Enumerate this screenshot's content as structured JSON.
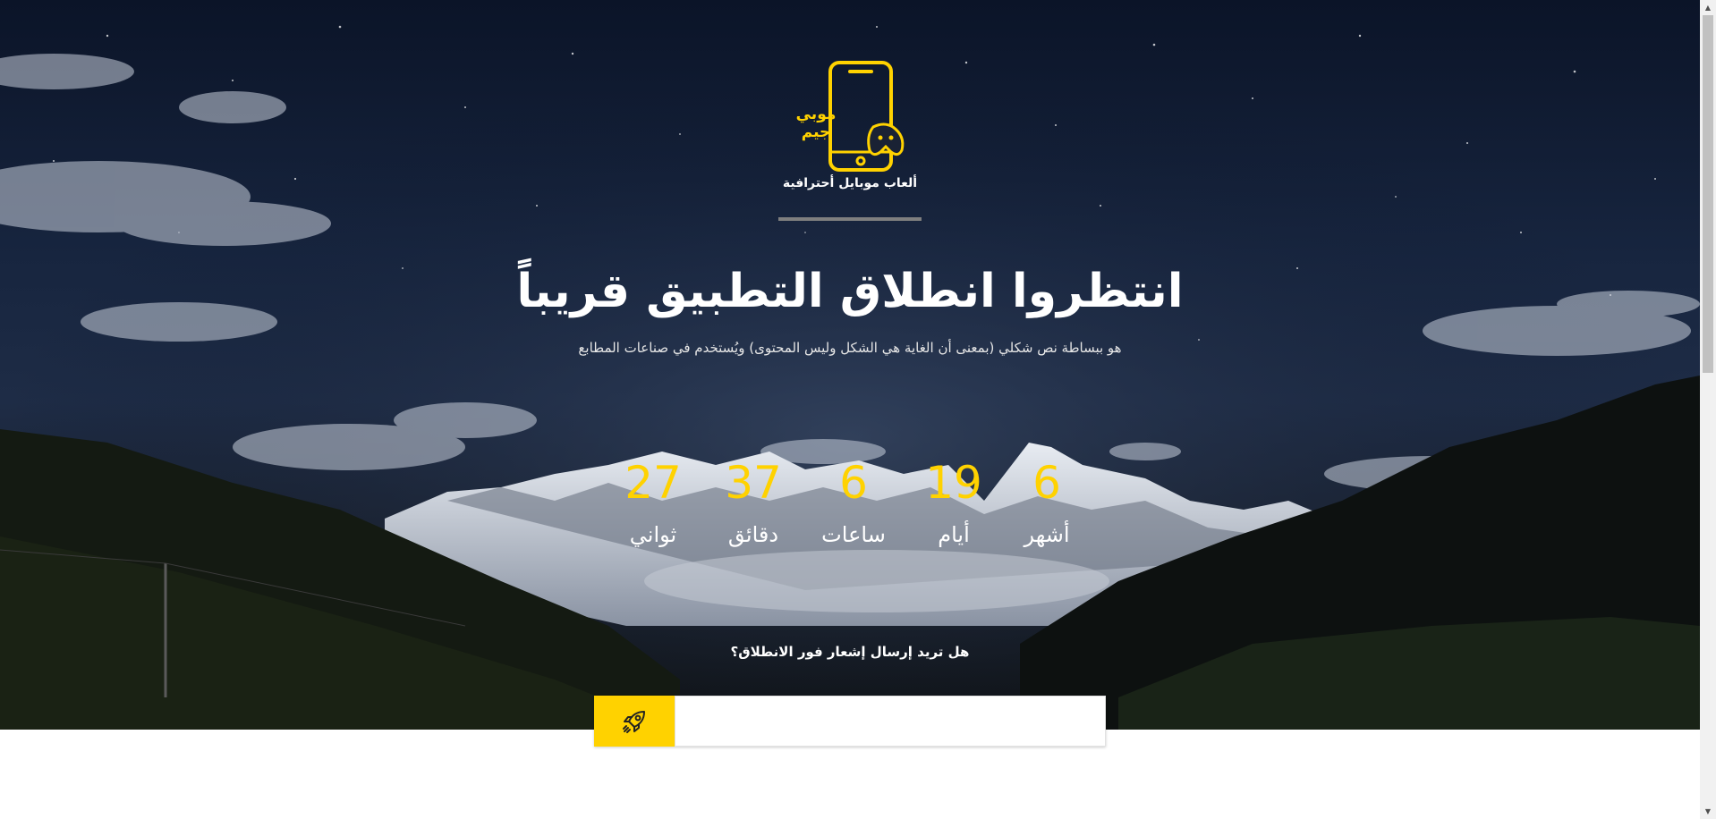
{
  "logo": {
    "title": "موبي جيم",
    "tagline": "ألعاب موبايل أحترافية",
    "icon": "phone-gamepad-icon"
  },
  "hero": {
    "headline": "انتظروا انطلاق التطبيق قريباً",
    "subtext": "هو ببساطة نص شكلي (بمعنى أن الغاية هي الشكل وليس المحتوى) ويُستخدم في صناعات المطابع"
  },
  "countdown": {
    "months": {
      "value": "6",
      "label": "أشهر"
    },
    "days": {
      "value": "19",
      "label": "أيام"
    },
    "hours": {
      "value": "6",
      "label": "ساعات"
    },
    "minutes": {
      "value": "37",
      "label": "دقائق"
    },
    "seconds": {
      "value": "27",
      "label": "ثواني"
    }
  },
  "notify": {
    "prompt": "هل تريد إرسال إشعار فور الانطلاق؟",
    "input_value": "",
    "button_icon": "rocket-icon"
  },
  "colors": {
    "accent": "#ffd200",
    "text": "#ffffff",
    "divider": "#7f7f7f"
  }
}
